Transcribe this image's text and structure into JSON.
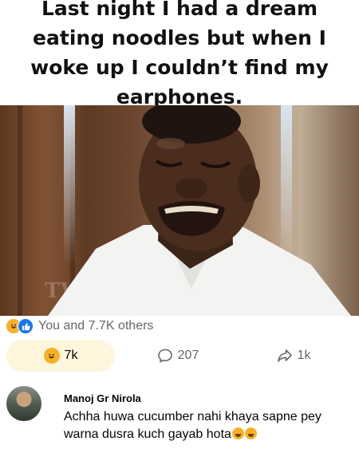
{
  "post": {
    "caption": "Last night I had a dream eating noodles but when I woke up I couldn’t find my earphones."
  },
  "reactions": {
    "summary": "You and 7.7K others",
    "icons": [
      "haha-icon",
      "like-icon"
    ]
  },
  "actions": {
    "reaction_count": "7k",
    "comment_count": "207",
    "share_count": "1k"
  },
  "comment": {
    "author": "Manoj Gr Nirola",
    "line1": "Achha huwa cucumber nahi khaya sapne pey",
    "line2": "warna dusra kuch gayab hota",
    "emoji": [
      "rofl-emoji",
      "rofl-emoji"
    ]
  },
  "colors": {
    "accent": "#1877f2",
    "haha": "#f7b125",
    "muted": "#65676b",
    "reacted_bg": "#fdf6dc"
  }
}
